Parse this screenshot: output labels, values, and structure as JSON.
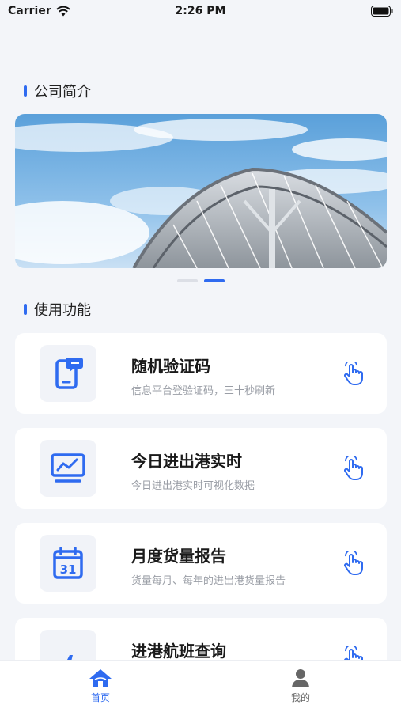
{
  "status": {
    "carrier": "Carrier",
    "time": "2:26 PM"
  },
  "sections": {
    "company": "公司简介",
    "functions": "使用功能"
  },
  "banner": {
    "page_index": 2,
    "page_count": 2
  },
  "cards": [
    {
      "title": "随机验证码",
      "desc": "信息平台登验证码，三十秒刷新",
      "icon": "phone-message-icon"
    },
    {
      "title": "今日进出港实时",
      "desc": "今日进出港实时可视化数据",
      "icon": "chart-monitor-icon"
    },
    {
      "title": "月度货量报告",
      "desc": "货量每月、每年的进出港货量报告",
      "icon": "calendar-31-icon"
    },
    {
      "title": "进港航班查询",
      "desc": "",
      "icon": "airplane-icon"
    }
  ],
  "calendar_day": "31",
  "tabs": {
    "home": "首页",
    "mine": "我的"
  },
  "colors": {
    "accent": "#2f6bf0",
    "background": "#f3f5f9"
  }
}
